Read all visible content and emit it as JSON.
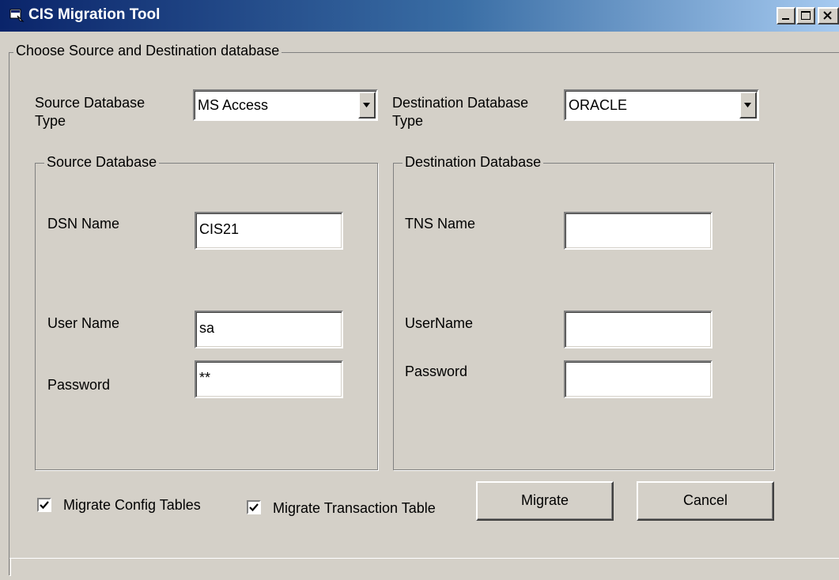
{
  "window": {
    "title": "CIS Migration Tool",
    "controls": [
      "minimize-icon",
      "maximize-icon",
      "close-icon"
    ]
  },
  "main_group": {
    "legend": "Choose Source and Destination database"
  },
  "source_type": {
    "label_line1": "Source Database",
    "label_line2": "Type",
    "value": "MS Access"
  },
  "destination_type": {
    "label_line1": "Destination Database",
    "label_line2": "Type",
    "value": "ORACLE"
  },
  "source_db": {
    "legend": "Source Database",
    "dsn_label": "DSN Name",
    "dsn_value": "CIS21",
    "user_label": "User Name",
    "user_value": "sa",
    "password_label": "Password",
    "password_value": "**"
  },
  "destination_db": {
    "legend": "Destination Database",
    "tns_label": "TNS Name",
    "tns_value": "",
    "user_label": "UserName",
    "user_value": "",
    "password_label": "Password",
    "password_value": ""
  },
  "options": {
    "config_label": "Migrate Config Tables",
    "config_checked": true,
    "transaction_label": "Migrate Transaction Table",
    "transaction_checked": true
  },
  "buttons": {
    "migrate": "Migrate",
    "cancel": "Cancel"
  },
  "colors": {
    "face": "#d4d0c8",
    "title_start": "#0a246a",
    "title_end": "#a6caf0"
  }
}
